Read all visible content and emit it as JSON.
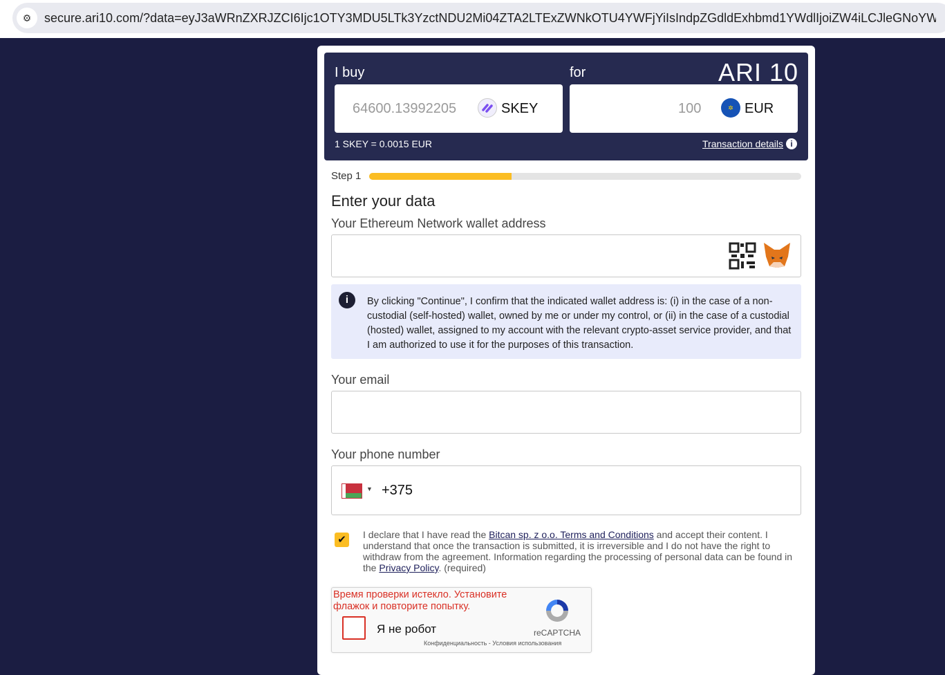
{
  "browser": {
    "url": "secure.ari10.com/?data=eyJ3aWRnZXRJZCI6Ijc1OTY3MDU5LTk3YzctNDU2Mi04ZTA2LTExZWNkOTU4YWFjYiIsIndpZGdldExhbmd1YWdlIjoiZW4iLCJleGNoYW5nZURhd..."
  },
  "header": {
    "buy_label": "I buy",
    "for_label": "for",
    "logo": "ARI 10",
    "buy_amount": "64600.13992205",
    "buy_currency": "SKEY",
    "pay_amount": "100",
    "pay_currency": "EUR",
    "rate": "1 SKEY = 0.0015 EUR",
    "details_link": "Transaction details"
  },
  "progress": {
    "step_label": "Step 1",
    "percent": 33
  },
  "form": {
    "title": "Enter your data",
    "wallet_label": "Your Ethereum Network wallet address",
    "wallet_value": "",
    "notice": "By clicking \"Continue\", I confirm that the indicated wallet address is: (i) in the case of a non-custodial (self-hosted) wallet, owned by me or under my control, or (ii) in the case of a custodial (hosted) wallet, assigned to my account with the relevant crypto-asset service provider, and that I am authorized to use it for the purposes of this transaction.",
    "email_label": "Your email",
    "email_value": "",
    "phone_label": "Your phone number",
    "phone_code": "+375",
    "declare_1": "I declare that I have read the ",
    "terms_link": "Bitcan sp. z o.o. Terms and Conditions",
    "declare_2": " and accept their content. I understand that once the transaction is submitted, it is irreversible and I do not have the right to withdraw from the agreement. Information regarding the processing of personal data can be found in the ",
    "privacy_link": "Privacy Policy",
    "declare_3": ". (required)",
    "declare_checked": true
  },
  "captcha": {
    "error": "Время проверки истекло. Установите флажок и повторите попытку.",
    "label": "Я не робот",
    "brand": "reCAPTCHA",
    "privacy": "Конфиденциальность",
    "sep": " - ",
    "terms": "Условия использования"
  },
  "colors": {
    "accent": "#fbbd23",
    "navy": "#262a50"
  }
}
